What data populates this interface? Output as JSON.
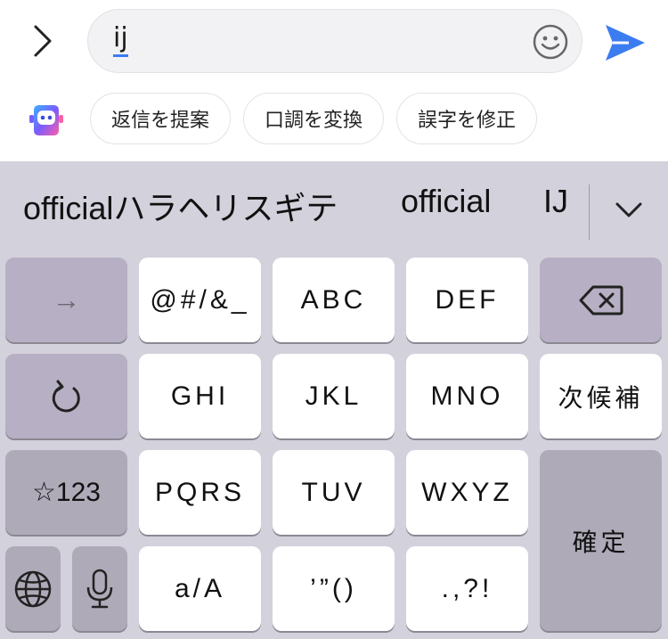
{
  "compose": {
    "input_value": "ij",
    "colors": {
      "accent": "#3b7cf0",
      "send": "#3b7cf0"
    },
    "icons": [
      "chevron-right-icon",
      "emoji-icon",
      "send-icon"
    ]
  },
  "suggestions": {
    "ai_icon": "ai-assistant-icon",
    "chips": [
      "返信を提案",
      "口調を変換",
      "誤字を修正"
    ]
  },
  "keyboard": {
    "candidates": [
      "officialハラヘリスギテ",
      "official",
      "IJ"
    ],
    "candidate_more_icon": "chevron-down-icon",
    "keys": {
      "arrow": "→",
      "symbols": "@#/&_",
      "abc": "ABC",
      "def": "DEF",
      "backspace_icon": "backspace-icon",
      "undo_icon": "undo-icon",
      "ghi": "GHI",
      "jkl": "JKL",
      "mno": "MNO",
      "next_candidate": "次候補",
      "numbers": "☆123",
      "pqrs": "PQRS",
      "tuv": "TUV",
      "wxyz": "WXYZ",
      "confirm": "確定",
      "globe_icon": "globe-icon",
      "mic_icon": "microphone-icon",
      "case": "a/A",
      "quotes": "’”()",
      "punct": ".,?!"
    }
  }
}
